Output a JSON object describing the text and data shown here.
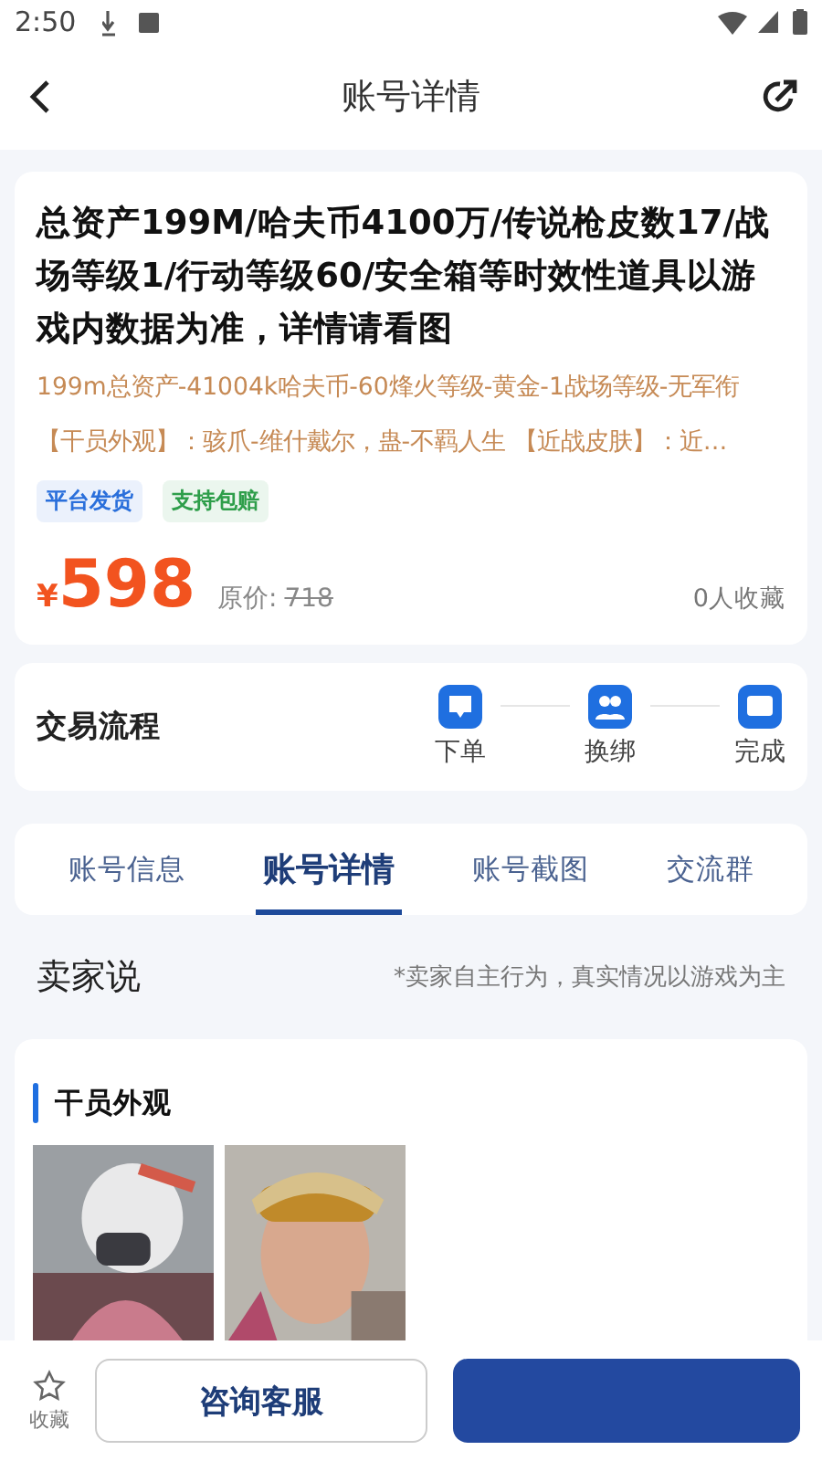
{
  "status_bar": {
    "time": "2:50"
  },
  "header": {
    "title": "账号详情"
  },
  "product": {
    "title": "总资产199M/哈夫币4100万/传说枪皮数17/战场等级1/行动等级60/安全箱等时效性道具以游戏内数据为准，详情请看图",
    "summary_lines": [
      "199m总资产-41004k哈夫币-60烽火等级-黄金-1战场等级-无军衔",
      "【干员外观】：骇爪-维什戴尔，蛊-不羁人生 【近战皮肤】：近…"
    ],
    "tags": [
      {
        "label": "平台发货",
        "color": "#2a6fdb"
      },
      {
        "label": "支持包赔",
        "color": "#2e9e4a"
      }
    ],
    "currency": "¥",
    "price": "598",
    "original_label": "原价:",
    "original_price": "718",
    "favorites": "0人收藏"
  },
  "process": {
    "title": "交易流程",
    "steps": [
      {
        "kind": "order",
        "label": "下单"
      },
      {
        "kind": "bind",
        "label": "换绑"
      },
      {
        "kind": "done",
        "label": "完成"
      }
    ]
  },
  "tabs": [
    {
      "label": "账号信息",
      "selected": false
    },
    {
      "label": "账号详情",
      "selected": true
    },
    {
      "label": "账号截图",
      "selected": false
    },
    {
      "label": "交流群",
      "selected": false
    }
  ],
  "seller": {
    "title": "卖家说",
    "note": "*卖家自主行为，真实情况以游戏为主",
    "section_title": "干员外观"
  },
  "bottom_bar": {
    "favorite_label": "收藏",
    "consult_button": "咨询客服"
  }
}
